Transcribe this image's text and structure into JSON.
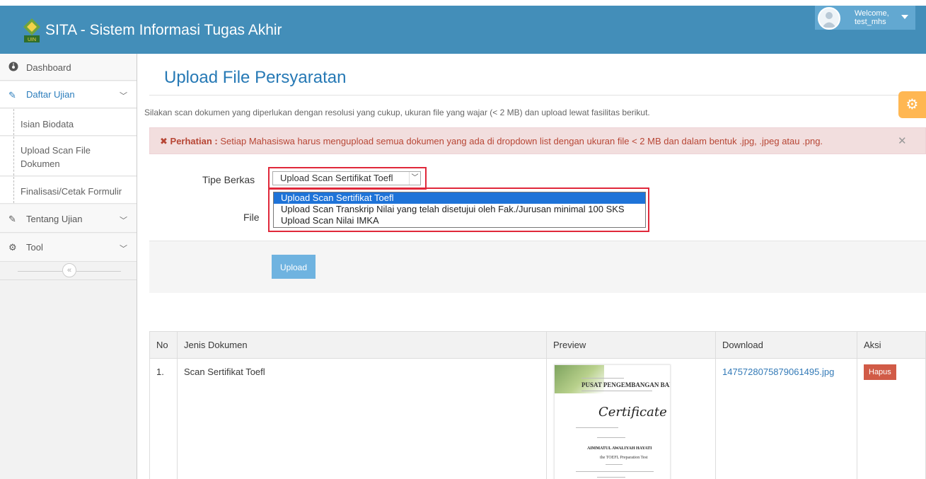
{
  "header": {
    "brand": "SITA - Sistem Informasi Tugas Akhir",
    "welcome_line1": "Welcome,",
    "welcome_line2": "test_mhs",
    "bar_color": "#438eb9"
  },
  "sidebar": {
    "dashboard": "Dashboard",
    "daftar_ujian": "Daftar Ujian",
    "sub_items": [
      "Isian Biodata",
      "Upload Scan File Dokumen",
      "Finalisasi/Cetak Formulir"
    ],
    "tentang_ujian": "Tentang Ujian",
    "tool": "Tool",
    "collapse_glyph": "«"
  },
  "main": {
    "title": "Upload File Persyaratan",
    "intro": "Silakan scan dokumen yang diperlukan dengan resolusi yang cukup, ukuran file yang wajar (< 2 MB) dan upload lewat fasilitas berikut.",
    "alert_label": "Perhatian :",
    "alert_text": "Setiap Mahasiswa harus mengupload semua dokumen yang ada di dropdown list dengan ukuran file < 2 MB dan dalam bentuk .jpg, .jpeg atau .png.",
    "tipe_label": "Tipe Berkas",
    "file_label": "File",
    "selected_option": "Upload Scan Sertifikat Toefl",
    "options": [
      "Upload Scan Sertifikat Toefl",
      "Upload Scan Transkrip Nilai yang telah disetujui oleh Fak./Jurusan minimal 100 SKS",
      "Upload Scan Nilai IMKA"
    ],
    "upload_button": "Upload"
  },
  "table": {
    "headers": [
      "No",
      "Jenis Dokumen",
      "Preview",
      "Download",
      "Aksi"
    ],
    "rows": [
      {
        "no": "1.",
        "jenis": "Scan Sertifikat Toefl",
        "download": "1475728075879061495.jpg",
        "aksi": "Hapus"
      }
    ]
  },
  "preview": {
    "org": "PUSAT PENGEMBANGAN BAHASA",
    "title": "Certificate",
    "name": "AIMMATUL AWALIYAH HAYATI",
    "test": "the TOEFL Preparation Test"
  }
}
